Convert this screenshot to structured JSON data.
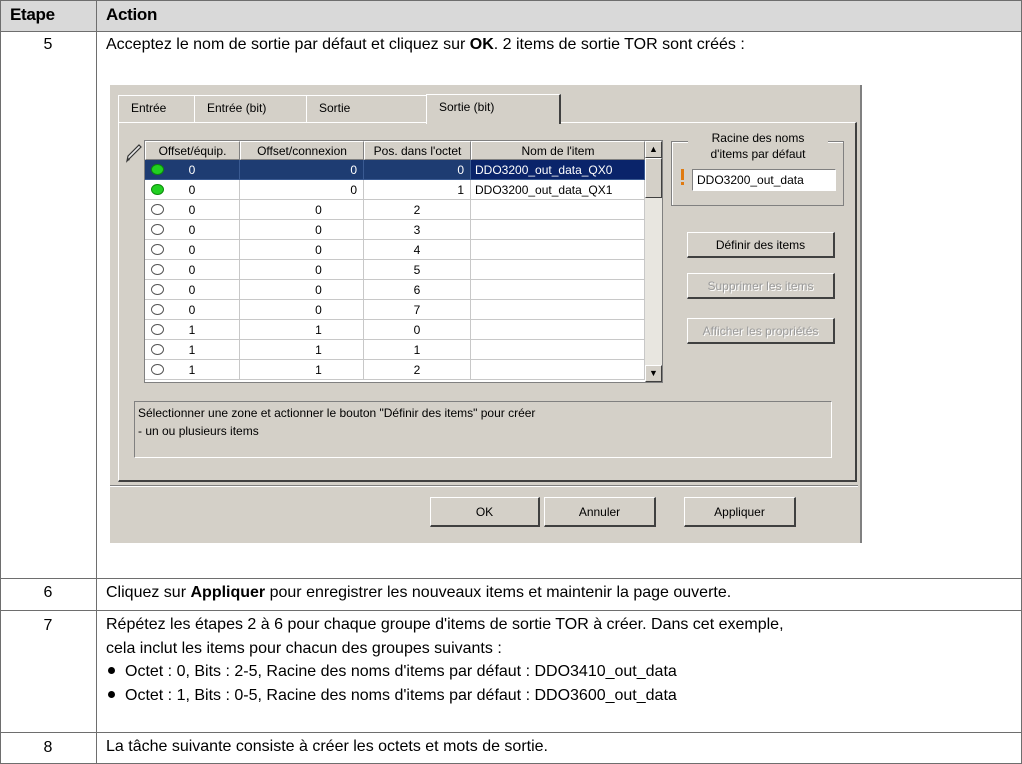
{
  "table": {
    "header": {
      "step": "Etape",
      "action": "Action"
    },
    "rows": [
      {
        "step": "5",
        "text_pre": "Acceptez le nom de sortie par défaut et cliquez sur ",
        "text_bold": "OK",
        "text_post": ". 2 items de sortie TOR sont créés :"
      },
      {
        "step": "6",
        "text_pre": "Cliquez sur ",
        "text_bold": "Appliquer",
        "text_post": " pour enregistrer les nouveaux items et maintenir la page ouverte."
      },
      {
        "step": "7",
        "line1": "Répétez les étapes 2 à 6 pour chaque groupe d'items de sortie TOR à créer. Dans cet exemple,",
        "line2": "cela inclut les items pour chacun des groupes suivants :",
        "bullets": [
          "Octet : 0, Bits : 2-5, Racine des noms d'items par défaut : DDO3410_out_data",
          "Octet : 1, Bits : 0-5, Racine des noms d'items par défaut : DDO3600_out_data"
        ]
      },
      {
        "step": "8",
        "text": "La tâche suivante consiste à créer les octets et mots de sortie."
      }
    ]
  },
  "dialog": {
    "tabs": [
      "Entrée",
      "Entrée (bit)",
      "Sortie",
      "Sortie (bit)"
    ],
    "active_tab": "Sortie (bit)",
    "grid": {
      "columns": [
        "Offset/équip.",
        "Offset/connexion",
        "Pos. dans l'octet",
        "Nom de l'item"
      ],
      "rows": [
        {
          "status": "on",
          "offset_equip": "0",
          "offset_conn": "0",
          "pos": "0",
          "name": "DDO3200_out_data_QX0",
          "selected": true
        },
        {
          "status": "on",
          "offset_equip": "0",
          "offset_conn": "0",
          "pos": "1",
          "name": "DDO3200_out_data_QX1",
          "selected": false
        },
        {
          "status": "off",
          "offset_equip": "0",
          "offset_conn": "0",
          "pos": "2",
          "name": "",
          "selected": false
        },
        {
          "status": "off",
          "offset_equip": "0",
          "offset_conn": "0",
          "pos": "3",
          "name": "",
          "selected": false
        },
        {
          "status": "off",
          "offset_equip": "0",
          "offset_conn": "0",
          "pos": "4",
          "name": "",
          "selected": false
        },
        {
          "status": "off",
          "offset_equip": "0",
          "offset_conn": "0",
          "pos": "5",
          "name": "",
          "selected": false
        },
        {
          "status": "off",
          "offset_equip": "0",
          "offset_conn": "0",
          "pos": "6",
          "name": "",
          "selected": false
        },
        {
          "status": "off",
          "offset_equip": "0",
          "offset_conn": "0",
          "pos": "7",
          "name": "",
          "selected": false
        },
        {
          "status": "off",
          "offset_equip": "1",
          "offset_conn": "1",
          "pos": "0",
          "name": "",
          "selected": false
        },
        {
          "status": "off",
          "offset_equip": "1",
          "offset_conn": "1",
          "pos": "1",
          "name": "",
          "selected": false
        },
        {
          "status": "off",
          "offset_equip": "1",
          "offset_conn": "1",
          "pos": "2",
          "name": "",
          "selected": false
        }
      ]
    },
    "root_group_label_1": "Racine des noms",
    "root_group_label_2": "d'items par défaut",
    "root_value": "DDO3200_out_data",
    "buttons": {
      "define": "Définir des items",
      "delete": "Supprimer les items",
      "properties": "Afficher les propriétés",
      "ok": "OK",
      "cancel": "Annuler",
      "apply": "Appliquer"
    },
    "info_line1": "Sélectionner une zone et actionner le bouton \"Définir des items\" pour créer",
    "info_line2": "- un ou plusieurs items",
    "colors": {
      "selected_row": "#1e3c72",
      "status_on": "#22d022",
      "dialog_bg": "#d4d0c8"
    }
  }
}
